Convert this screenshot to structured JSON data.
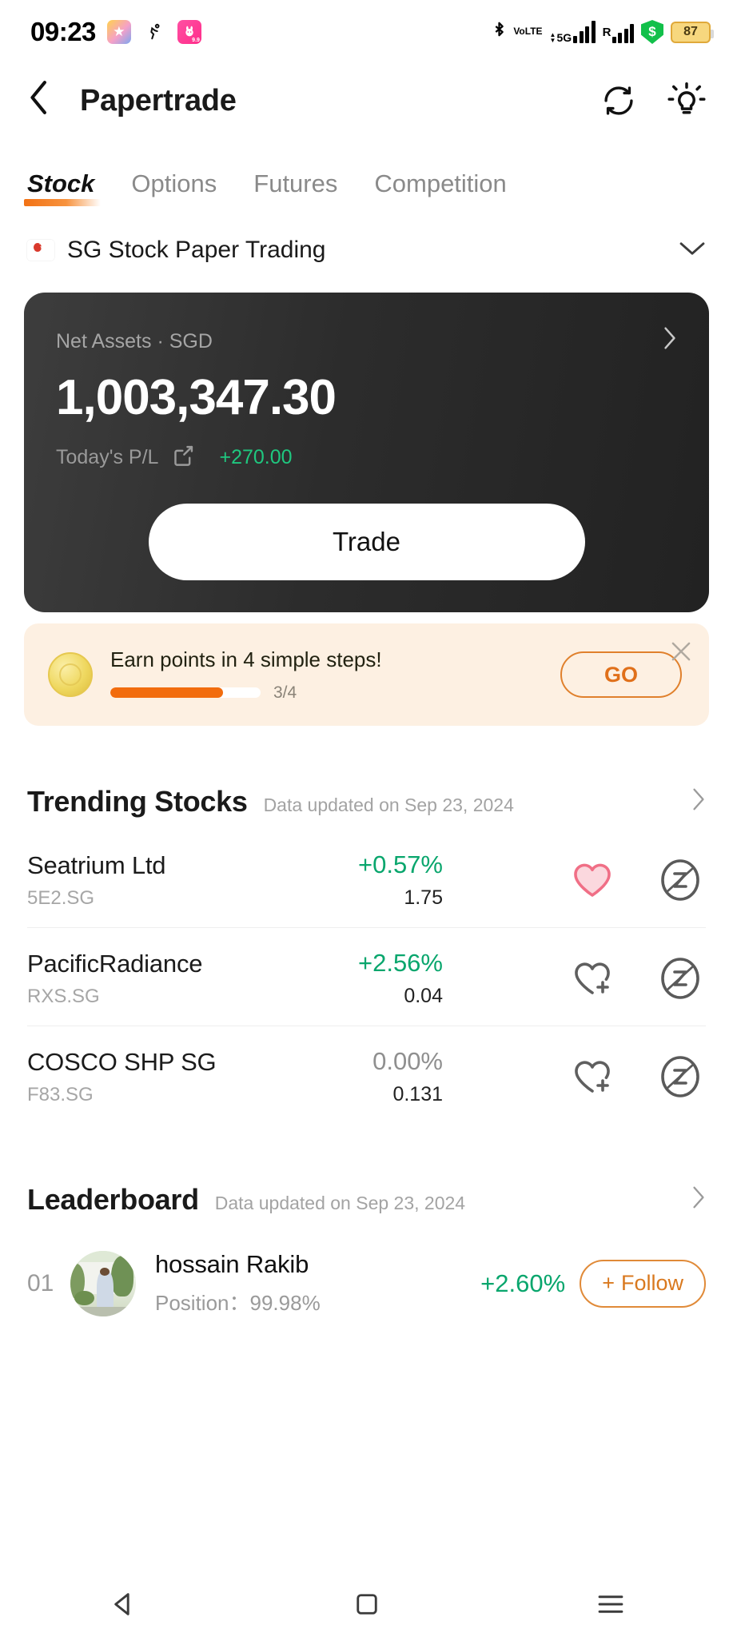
{
  "status_bar": {
    "time": "09:23",
    "apps": [
      {
        "name": "star-app-icon",
        "glyph": "★"
      },
      {
        "name": "running-app-icon",
        "glyph": "🏃"
      },
      {
        "name": "pink-app-icon",
        "glyph": "🐰",
        "badge": "9.9"
      }
    ],
    "bluetooth": "bluetooth-icon",
    "volte_line1": "Vo",
    "volte_line2": "LTE",
    "network_type": "5G",
    "roaming_label": "R",
    "shield_glyph": "$",
    "battery": "87"
  },
  "navbar": {
    "back": "back-chevron",
    "title": "Papertrade",
    "refresh": "refresh-icon",
    "tips": "lightbulb-icon"
  },
  "tabs": [
    {
      "label": "Stock",
      "active": true
    },
    {
      "label": "Options",
      "active": false
    },
    {
      "label": "Futures",
      "active": false
    },
    {
      "label": "Competition",
      "active": false
    }
  ],
  "account": {
    "flag": "singapore-flag",
    "name": "SG Stock Paper Trading",
    "chevron": "⌄"
  },
  "asset_card": {
    "label": "Net Assets · SGD",
    "arrow": "›",
    "balance": "1,003,347.30",
    "pl_label": "Today's P/L",
    "share_icon": "share-icon",
    "pl_value": "+270.00",
    "pl_color": "#1fc77f",
    "trade_button": "Trade"
  },
  "promo": {
    "coin_icon": "coin-icon",
    "title": "Earn points in 4 simple steps!",
    "progress_text": "3/4",
    "progress_percent": 75,
    "go_label": "GO",
    "close": "✕",
    "accent": "#e0701a",
    "background": "#fdf0e2"
  },
  "trending": {
    "title": "Trending Stocks",
    "subtitle": "Data updated on Sep 23, 2024",
    "arrow": "›",
    "rows": [
      {
        "name": "Seatrium Ltd",
        "symbol": "5E2.SG",
        "change": "+0.57%",
        "price": "1.75",
        "direction": "up",
        "favorited": true
      },
      {
        "name": "PacificRadiance",
        "symbol": "RXS.SG",
        "change": "+2.56%",
        "price": "0.04",
        "direction": "up",
        "favorited": false
      },
      {
        "name": "COSCO SHP SG",
        "symbol": "F83.SG",
        "change": "0.00%",
        "price": "0.131",
        "direction": "flat",
        "favorited": false
      }
    ]
  },
  "leaderboard": {
    "title": "Leaderboard",
    "subtitle": "Data updated on Sep 23, 2024",
    "arrow": "›",
    "rows": [
      {
        "rank": "01",
        "name": "hossain Rakib",
        "position_label": "Position：",
        "position_value": "99.98%",
        "change": "+2.60%",
        "follow_label": "Follow",
        "follow_plus": "+"
      }
    ]
  },
  "system_nav": {
    "back": "◁",
    "home": "▢",
    "recents": "☰"
  },
  "colors": {
    "accent_orange": "#f26c0d",
    "gain_green": "#09a66d",
    "card_dark": "#2c2c2c"
  }
}
